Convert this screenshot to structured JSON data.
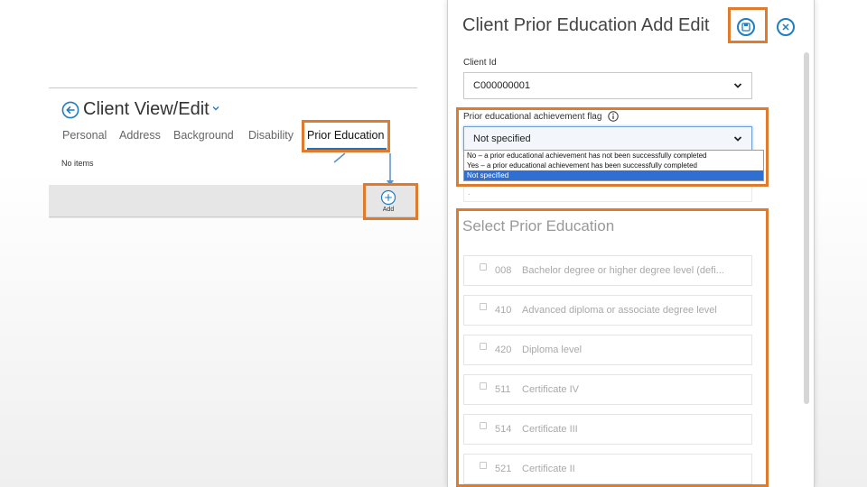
{
  "client_view": {
    "title": "Client View/Edit",
    "tabs": [
      "Personal",
      "Address",
      "Background",
      "Disability",
      "Prior Education"
    ],
    "active_tab": "Prior Education",
    "empty_text": "No items",
    "add_label": "Add"
  },
  "dialog": {
    "title": "Client Prior Education Add Edit",
    "client_id_label": "Client Id",
    "client_id_value": "C000000001",
    "flag_label": "Prior educational achievement flag",
    "flag_value": "Not specified",
    "flag_options": [
      "No – a prior educational achievement has not been successfully completed",
      "Yes – a prior educational achievement has been successfully completed",
      "Not specified"
    ],
    "faint_field_value": ".",
    "section_title": "Select Prior Education",
    "items": [
      {
        "code": "008",
        "label": "Bachelor degree or higher degree level (defi..."
      },
      {
        "code": "410",
        "label": "Advanced diploma or associate degree level"
      },
      {
        "code": "420",
        "label": "Diploma level"
      },
      {
        "code": "511",
        "label": "Certificate IV"
      },
      {
        "code": "514",
        "label": "Certificate III"
      },
      {
        "code": "521",
        "label": "Certificate II"
      }
    ]
  },
  "colors": {
    "accent": "#1f7dc1",
    "callout": "#e07b2e",
    "selected_option": "#2f6fd1"
  },
  "icons": [
    "back-arrow-icon",
    "chevron-down-icon",
    "plus-circle-icon",
    "save-icon",
    "close-icon",
    "info-icon"
  ]
}
